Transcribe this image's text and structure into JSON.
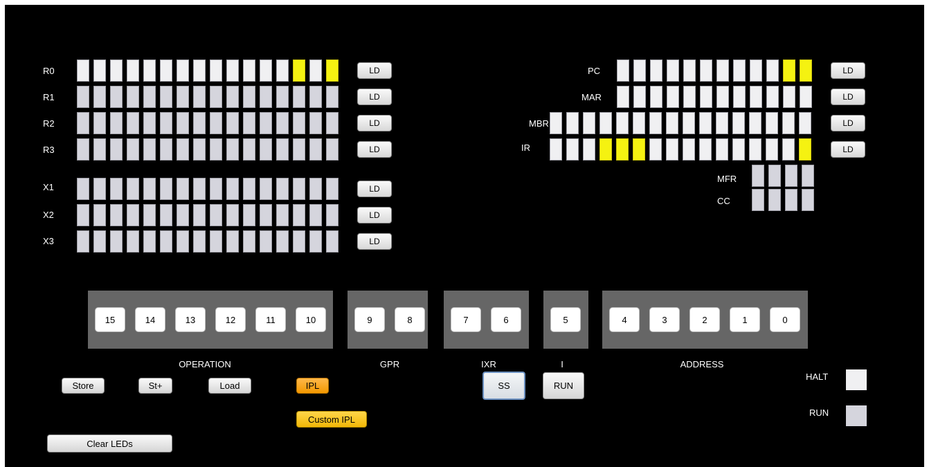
{
  "registers_left": [
    {
      "name": "R0",
      "ld": "LD",
      "bits": [
        0,
        0,
        0,
        0,
        0,
        0,
        0,
        0,
        0,
        0,
        0,
        0,
        0,
        1,
        0,
        1
      ],
      "style": "bright"
    },
    {
      "name": "R1",
      "ld": "LD",
      "bits": [
        0,
        0,
        0,
        0,
        0,
        0,
        0,
        0,
        0,
        0,
        0,
        0,
        0,
        0,
        0,
        0
      ],
      "style": "dim"
    },
    {
      "name": "R2",
      "ld": "LD",
      "bits": [
        0,
        0,
        0,
        0,
        0,
        0,
        0,
        0,
        0,
        0,
        0,
        0,
        0,
        0,
        0,
        0
      ],
      "style": "dim"
    },
    {
      "name": "R3",
      "ld": "LD",
      "bits": [
        0,
        0,
        0,
        0,
        0,
        0,
        0,
        0,
        0,
        0,
        0,
        0,
        0,
        0,
        0,
        0
      ],
      "style": "dim"
    },
    {
      "name": "X1",
      "ld": "LD",
      "bits": [
        0,
        0,
        0,
        0,
        0,
        0,
        0,
        0,
        0,
        0,
        0,
        0,
        0,
        0,
        0,
        0
      ],
      "style": "dim"
    },
    {
      "name": "X2",
      "ld": "LD",
      "bits": [
        0,
        0,
        0,
        0,
        0,
        0,
        0,
        0,
        0,
        0,
        0,
        0,
        0,
        0,
        0,
        0
      ],
      "style": "dim"
    },
    {
      "name": "X3",
      "ld": "LD",
      "bits": [
        0,
        0,
        0,
        0,
        0,
        0,
        0,
        0,
        0,
        0,
        0,
        0,
        0,
        0,
        0,
        0
      ],
      "style": "dim"
    }
  ],
  "registers_right": [
    {
      "name": "PC",
      "ld": "LD",
      "bits": [
        0,
        0,
        0,
        0,
        0,
        0,
        0,
        0,
        0,
        0,
        1,
        1
      ],
      "style": "bright"
    },
    {
      "name": "MAR",
      "ld": "LD",
      "bits": [
        0,
        0,
        0,
        0,
        0,
        0,
        0,
        0,
        0,
        0,
        0,
        0
      ],
      "style": "bright"
    },
    {
      "name": "MBR",
      "ld": "LD",
      "bits": [
        0,
        0,
        0,
        0,
        0,
        0,
        0,
        0,
        0,
        0,
        0,
        0,
        0,
        0,
        0,
        0
      ],
      "style": "bright"
    },
    {
      "name": "IR",
      "ld": "LD",
      "bits": [
        0,
        0,
        0,
        1,
        1,
        1,
        0,
        0,
        0,
        0,
        0,
        0,
        0,
        0,
        0,
        1
      ],
      "style": "bright"
    }
  ],
  "flags": [
    {
      "name": "MFR",
      "bits": [
        0,
        0,
        0,
        0
      ]
    },
    {
      "name": "CC",
      "bits": [
        0,
        0,
        0,
        0
      ]
    }
  ],
  "switch_groups": [
    {
      "label": "OPERATION",
      "switches": [
        "15",
        "14",
        "13",
        "12",
        "11",
        "10"
      ]
    },
    {
      "label": "GPR",
      "switches": [
        "9",
        "8"
      ]
    },
    {
      "label": "IXR",
      "switches": [
        "7",
        "6"
      ]
    },
    {
      "label": "I",
      "switches": [
        "5"
      ]
    },
    {
      "label": "ADDRESS",
      "switches": [
        "4",
        "3",
        "2",
        "1",
        "0"
      ]
    }
  ],
  "controls": {
    "store": "Store",
    "store_plus": "St+",
    "load": "Load",
    "ipl": "IPL",
    "custom_ipl": "Custom IPL",
    "ss": "SS",
    "run": "RUN",
    "clear_leds": "Clear LEDs"
  },
  "indicators": {
    "halt_label": "HALT",
    "halt_state": "off",
    "run_label": "RUN",
    "run_state": "off"
  },
  "colors": {
    "panel_bg": "#000000",
    "led_on": "#f5f211",
    "led_off": "#f0f0f2",
    "led_off_dim": "#d5d5dd",
    "switch_group_bg": "#666666",
    "ipl_button": "#f39800",
    "custom_ipl_button": "#f2b807"
  }
}
